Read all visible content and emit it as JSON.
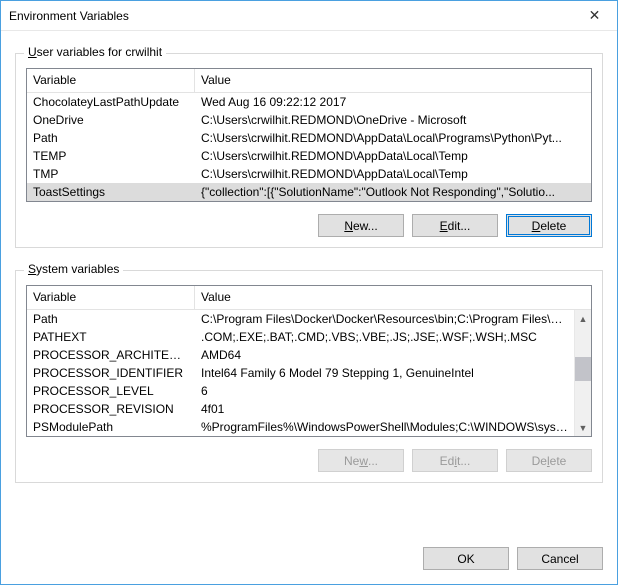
{
  "window": {
    "title": "Environment Variables",
    "close_icon_label": "✕"
  },
  "user_group": {
    "legend_prefix": "U",
    "legend_rest": "ser variables for crwilhit",
    "header_variable": "Variable",
    "header_value": "Value",
    "rows": [
      {
        "variable": "ChocolateyLastPathUpdate",
        "value": "Wed Aug 16 09:22:12 2017"
      },
      {
        "variable": "OneDrive",
        "value": "C:\\Users\\crwilhit.REDMOND\\OneDrive - Microsoft"
      },
      {
        "variable": "Path",
        "value": "C:\\Users\\crwilhit.REDMOND\\AppData\\Local\\Programs\\Python\\Pyt..."
      },
      {
        "variable": "TEMP",
        "value": "C:\\Users\\crwilhit.REDMOND\\AppData\\Local\\Temp"
      },
      {
        "variable": "TMP",
        "value": "C:\\Users\\crwilhit.REDMOND\\AppData\\Local\\Temp"
      },
      {
        "variable": "ToastSettings",
        "value": "{\"collection\":[{\"SolutionName\":\"Outlook Not Responding\",\"Solutio..."
      }
    ],
    "selected_index": 5,
    "buttons": {
      "new": "New...",
      "edit": "Edit...",
      "delete": "Delete"
    }
  },
  "system_group": {
    "legend_prefix": "S",
    "legend_rest": "ystem variables",
    "header_variable": "Variable",
    "header_value": "Value",
    "rows": [
      {
        "variable": "Path",
        "value": "C:\\Program Files\\Docker\\Docker\\Resources\\bin;C:\\Program Files\\N..."
      },
      {
        "variable": "PATHEXT",
        "value": ".COM;.EXE;.BAT;.CMD;.VBS;.VBE;.JS;.JSE;.WSF;.WSH;.MSC"
      },
      {
        "variable": "PROCESSOR_ARCHITECTURE",
        "value": "AMD64"
      },
      {
        "variable": "PROCESSOR_IDENTIFIER",
        "value": "Intel64 Family 6 Model 79 Stepping 1, GenuineIntel"
      },
      {
        "variable": "PROCESSOR_LEVEL",
        "value": "6"
      },
      {
        "variable": "PROCESSOR_REVISION",
        "value": "4f01"
      },
      {
        "variable": "PSModulePath",
        "value": "%ProgramFiles%\\WindowsPowerShell\\Modules;C:\\WINDOWS\\syst..."
      }
    ],
    "buttons": {
      "new": "New...",
      "edit": "Edit...",
      "delete": "Delete"
    }
  },
  "footer": {
    "ok": "OK",
    "cancel": "Cancel"
  }
}
